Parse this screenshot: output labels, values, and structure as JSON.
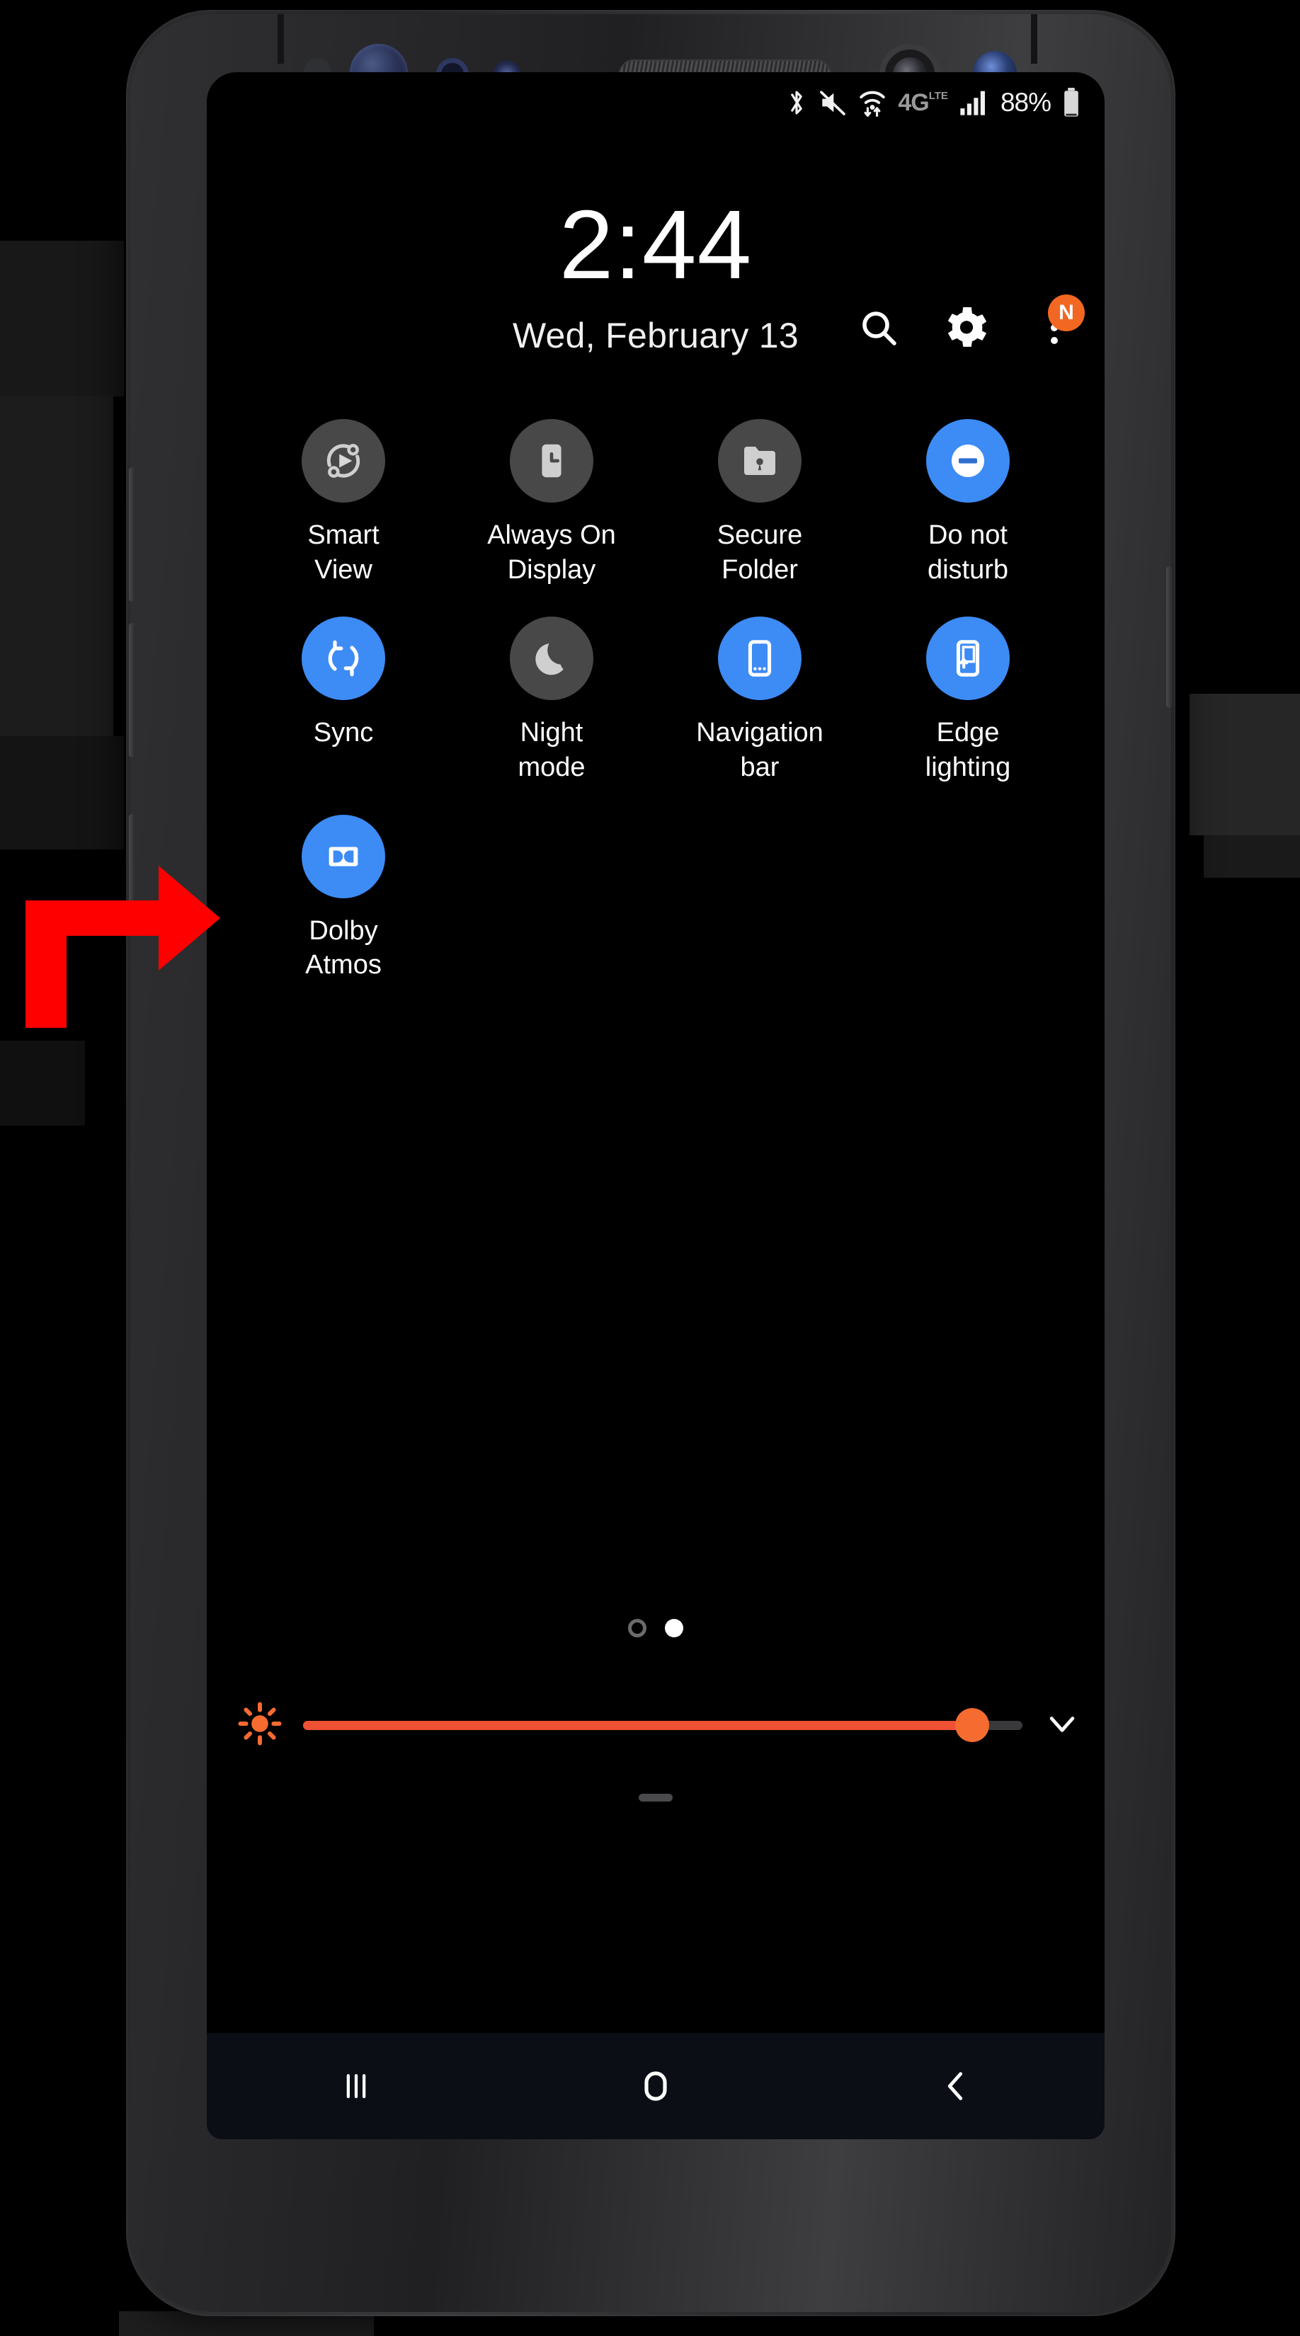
{
  "device": {
    "name": "samsung-galaxy-phone",
    "hardware": {
      "proximity_sensor": "proximity-sensor",
      "iris_scanner": "iris-scanner",
      "sensor_ring": "sensor-ring-icon",
      "small_sensor": "small-sensor-icon",
      "earpiece": "earpiece-speaker",
      "camera_ring": "camera-ring",
      "front_camera": "front-camera",
      "secondary_camera": "secondary-camera",
      "volume_up": "volume-up-button",
      "volume_down": "volume-down-button",
      "bixby": "bixby-button",
      "power": "power-button"
    }
  },
  "status_bar": {
    "icons": [
      {
        "name": "bluetooth-icon",
        "label": "Bluetooth"
      },
      {
        "name": "mute-icon",
        "label": "Sound off"
      },
      {
        "name": "wifi-icon",
        "label": "Wi-Fi with data transfer"
      },
      {
        "name": "network-type-icon",
        "label": "4G LTE"
      },
      {
        "name": "signal-bars-icon",
        "label": "Signal strength"
      }
    ],
    "network_type": "4G",
    "network_suffix": "LTE",
    "battery_percent": "88%",
    "battery_level": 88
  },
  "clock": {
    "time": "2:44",
    "date": "Wed, February 13"
  },
  "panel_actions": [
    {
      "name": "search-button",
      "icon": "search-icon",
      "label": "Search"
    },
    {
      "name": "settings-button",
      "icon": "gear-icon",
      "label": "Settings"
    },
    {
      "name": "more-options-button",
      "icon": "three-dots-icon",
      "label": "More options",
      "badge": "N"
    }
  ],
  "quick_settings": {
    "tiles": [
      {
        "name": "smart-view",
        "label": "Smart View",
        "icon": "smart-view-icon",
        "state": "off"
      },
      {
        "name": "always-on-display",
        "label": "Always On Display",
        "icon": "always-on-display-icon",
        "state": "off"
      },
      {
        "name": "secure-folder",
        "label": "Secure Folder",
        "icon": "secure-folder-icon",
        "state": "off"
      },
      {
        "name": "do-not-disturb",
        "label": "Do not disturb",
        "icon": "do-not-disturb-icon",
        "state": "on"
      },
      {
        "name": "sync",
        "label": "Sync",
        "icon": "sync-icon",
        "state": "on"
      },
      {
        "name": "night-mode",
        "label": "Night mode",
        "icon": "moon-icon",
        "state": "off"
      },
      {
        "name": "navigation-bar",
        "label": "Navigation bar",
        "icon": "navigation-bar-icon",
        "state": "on"
      },
      {
        "name": "edge-lighting",
        "label": "Edge lighting",
        "icon": "edge-lighting-icon",
        "state": "on"
      },
      {
        "name": "dolby-atmos",
        "label": "Dolby Atmos",
        "icon": "dolby-atmos-icon",
        "state": "on"
      }
    ],
    "pages": {
      "total": 2,
      "current": 2
    }
  },
  "brightness": {
    "name": "brightness-slider",
    "icon": "brightness-sun-icon",
    "value_percent": 93,
    "expand_icon": "chevron-down-icon"
  },
  "navigation_bar": [
    {
      "name": "recents-button",
      "icon": "recents-icon",
      "label": "Recents"
    },
    {
      "name": "home-button",
      "icon": "home-icon",
      "label": "Home"
    },
    {
      "name": "back-button",
      "icon": "back-icon",
      "label": "Back"
    }
  ],
  "annotation": {
    "name": "red-arrow-annotation",
    "points_to": "smart-view",
    "color": "#ff0000"
  },
  "colors": {
    "tile_active": "#3d8bf5",
    "tile_inactive": "#484848",
    "badge": "#f26722",
    "slider_fill": "#ef5134",
    "slider_thumb": "#f56b30",
    "screen_bg": "#000000",
    "navbar_bg": "#0b0e14"
  }
}
